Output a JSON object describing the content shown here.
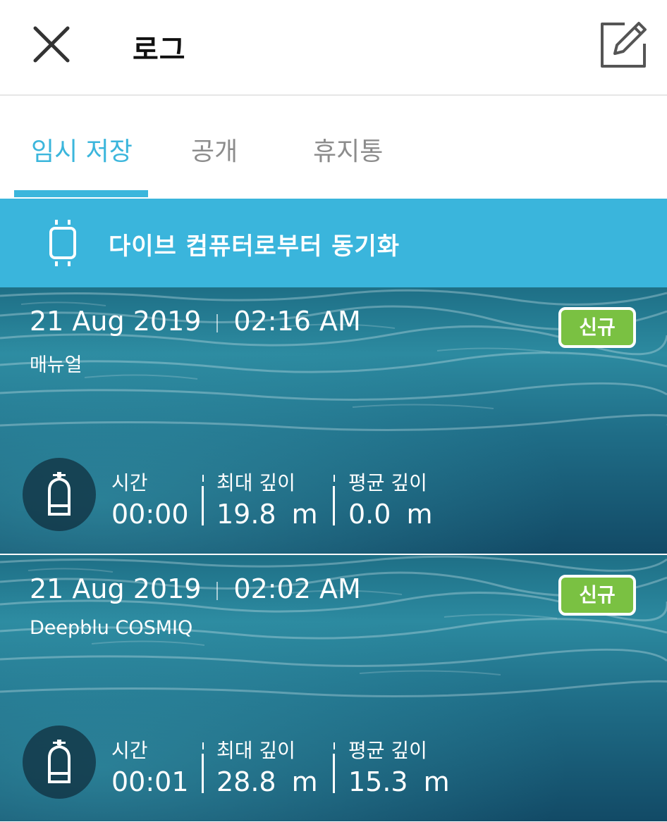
{
  "header": {
    "title": "로그"
  },
  "tabs": [
    {
      "label": "임시 저장",
      "active": true
    },
    {
      "label": "공개",
      "active": false
    },
    {
      "label": "휴지통",
      "active": false
    }
  ],
  "sync": {
    "label": "다이브 컴퓨터로부터 동기화"
  },
  "logs": [
    {
      "date": "21 Aug 2019",
      "time": "02:16 AM",
      "source": "매뉴얼",
      "badge": "신규",
      "time_label": "시간",
      "duration": "00:00",
      "max_depth_label": "최대 깊이",
      "max_depth": "19.8",
      "max_depth_unit": "m",
      "avg_depth_label": "평균 깊이",
      "avg_depth": "0.0",
      "avg_depth_unit": "m"
    },
    {
      "date": "21 Aug 2019",
      "time": "02:02 AM",
      "source": "Deepblu COSMIQ",
      "badge": "신규",
      "time_label": "시간",
      "duration": "00:01",
      "max_depth_label": "최대 깊이",
      "max_depth": "28.8",
      "max_depth_unit": "m",
      "avg_depth_label": "평균 깊이",
      "avg_depth": "15.3",
      "avg_depth_unit": "m"
    }
  ],
  "colors": {
    "accent": "#3bb6dc",
    "sync_bar": "#3ab5dc",
    "badge": "#7ac142",
    "tab_inactive": "#8c8c8c"
  },
  "icons": {
    "close": "close-icon",
    "edit": "edit-icon",
    "sync": "dive-computer-icon",
    "tank": "scuba-tank-icon"
  }
}
